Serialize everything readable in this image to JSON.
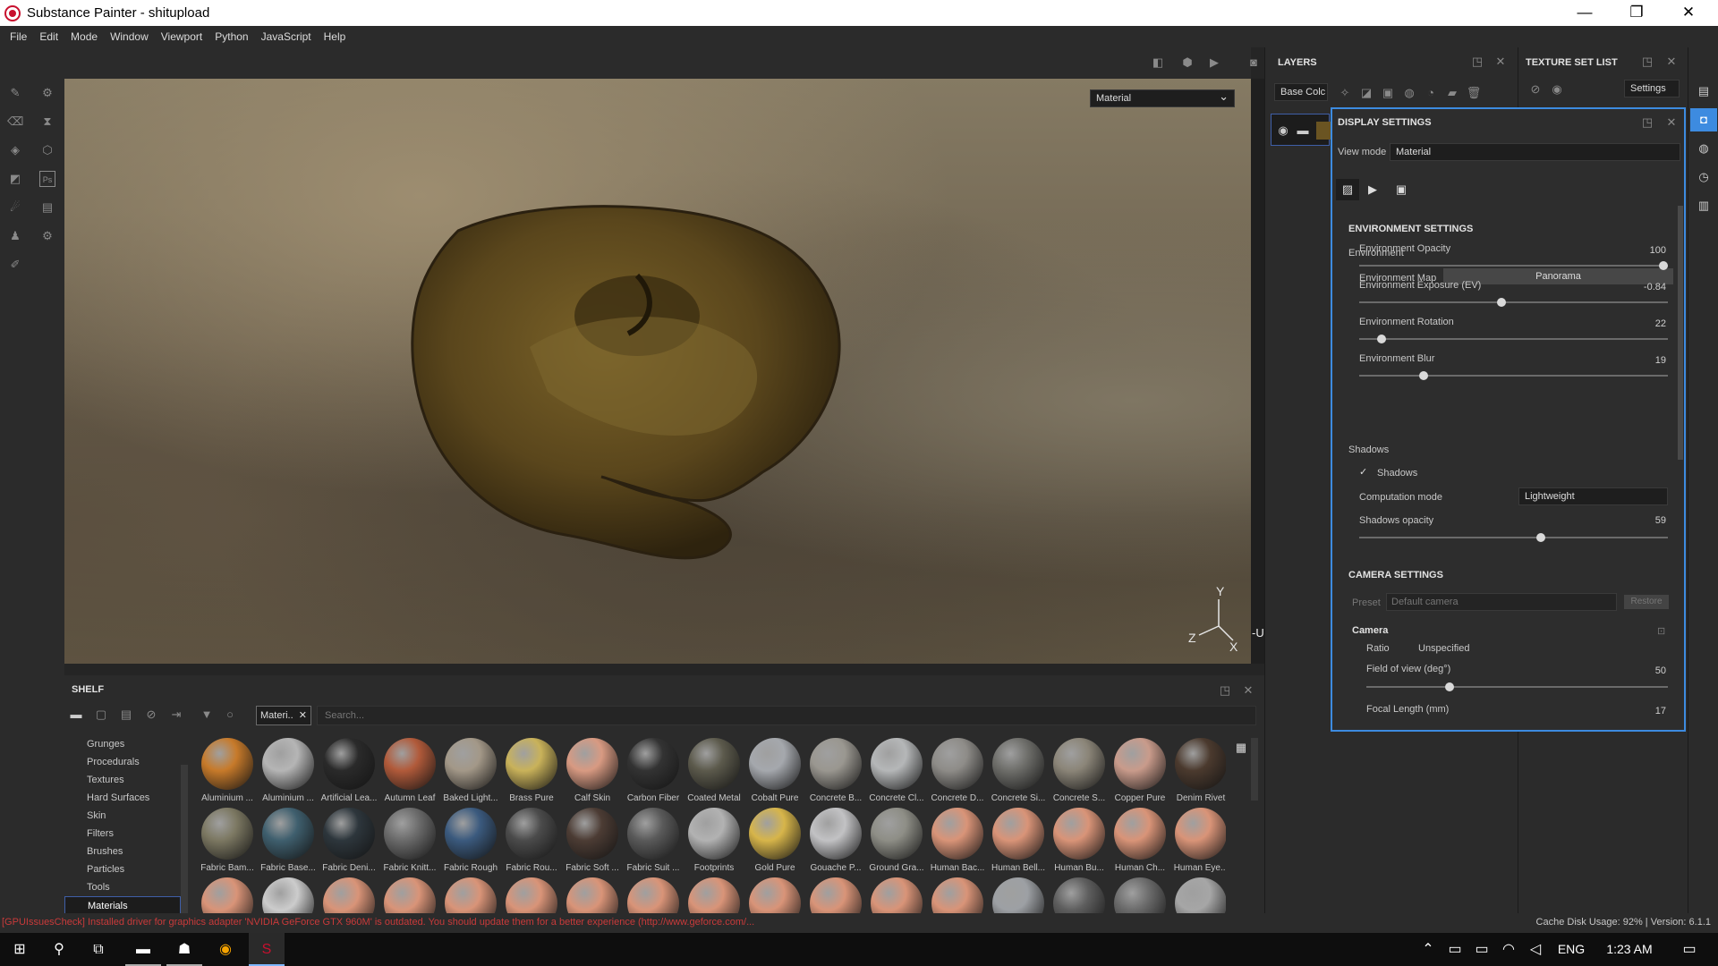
{
  "window": {
    "title": "Substance Painter - shitupload",
    "controls": [
      "—",
      "❐",
      "✕"
    ]
  },
  "menu": [
    "File",
    "Edit",
    "Mode",
    "Window",
    "Viewport",
    "Python",
    "JavaScript",
    "Help"
  ],
  "viewport": {
    "mode_select": "Material",
    "gizmo_labels": {
      "y": "Y",
      "z": "Z",
      "x": "X",
      "u": "-U"
    }
  },
  "layers": {
    "title": "LAYERS",
    "channel_select": "Base Colc"
  },
  "texture_set_list": {
    "title": "TEXTURE SET LIST",
    "settings_label": "Settings"
  },
  "display_settings": {
    "title": "DISPLAY SETTINGS",
    "view_mode_label": "View mode",
    "view_mode_value": "Material",
    "env_section": "ENVIRONMENT SETTINGS",
    "env_group": "Environment",
    "env_map_label": "Environment Map",
    "env_map_value": "Panorama",
    "sliders": [
      {
        "label": "Environment Opacity",
        "value": "100",
        "fraction": 1.0
      },
      {
        "label": "Environment Exposure (EV)",
        "value": "-0.84",
        "fraction": 0.46
      },
      {
        "label": "Environment Rotation",
        "value": "22",
        "fraction": 0.06
      },
      {
        "label": "Environment Blur",
        "value": "19",
        "fraction": 0.2
      }
    ],
    "shadows_group": "Shadows",
    "shadows_checkbox": "Shadows",
    "computation_label": "Computation mode",
    "computation_value": "Lightweight",
    "shadows_opacity_label": "Shadows opacity",
    "shadows_opacity_value": "59",
    "shadows_opacity_fraction": 0.59,
    "camera_section": "CAMERA SETTINGS",
    "preset_label": "Preset",
    "preset_placeholder": "Default camera",
    "restore_label": "Restore",
    "camera_group": "Camera",
    "ratio_label": "Ratio",
    "ratio_value": "Unspecified",
    "fov_label": "Field of view (deg°)",
    "fov_value": "50",
    "fov_fraction": 0.27,
    "focal_label": "Focal Length (mm)",
    "focal_value": "17"
  },
  "shelf": {
    "title": "SHELF",
    "filter_chip": "Materi..",
    "search_placeholder": "Search...",
    "categories": [
      "Grunges",
      "Procedurals",
      "Textures",
      "Hard Surfaces",
      "Skin",
      "Filters",
      "Brushes",
      "Particles",
      "Tools",
      "Materials"
    ],
    "selected_category": "Materials",
    "materials_row1": [
      {
        "name": "Aluminium ...",
        "color": "#c77a2a"
      },
      {
        "name": "Aluminium ...",
        "color": "#b5b5b5"
      },
      {
        "name": "Artificial Lea...",
        "color": "#2a2a2a"
      },
      {
        "name": "Autumn Leaf",
        "color": "#b15a3a"
      },
      {
        "name": "Baked Light...",
        "color": "#a39888"
      },
      {
        "name": "Brass Pure",
        "color": "#c9b25a"
      },
      {
        "name": "Calf Skin",
        "color": "#d89a82"
      },
      {
        "name": "Carbon Fiber",
        "color": "#333"
      },
      {
        "name": "Coated Metal",
        "color": "#5c5a4c"
      },
      {
        "name": "Cobalt Pure",
        "color": "#a5a8ad"
      },
      {
        "name": "Concrete B...",
        "color": "#9a9790"
      },
      {
        "name": "Concrete Cl...",
        "color": "#b5b7b8"
      },
      {
        "name": "Concrete D...",
        "color": "#8e8c88"
      },
      {
        "name": "Concrete Si...",
        "color": "#6e6e6a"
      },
      {
        "name": "Concrete S...",
        "color": "#8b8578"
      },
      {
        "name": "Copper Pure",
        "color": "#c99b8b"
      },
      {
        "name": "Denim Rivet",
        "color": "#4b3a2e"
      }
    ],
    "materials_row2": [
      {
        "name": "Fabric Bam...",
        "color": "#7c7862"
      },
      {
        "name": "Fabric Base...",
        "color": "#3f5f6e"
      },
      {
        "name": "Fabric Deni...",
        "color": "#2d363c"
      },
      {
        "name": "Fabric Knitt...",
        "color": "#6b6b6b"
      },
      {
        "name": "Fabric Rough",
        "color": "#3b5a7e"
      },
      {
        "name": "Fabric Rou...",
        "color": "#4b4b4b"
      },
      {
        "name": "Fabric Soft ...",
        "color": "#4c3c34"
      },
      {
        "name": "Fabric Suit ...",
        "color": "#5a5a5a"
      },
      {
        "name": "Footprints",
        "color": "#b2b2b2"
      },
      {
        "name": "Gold Pure",
        "color": "#d7b54a"
      },
      {
        "name": "Gouache P...",
        "color": "#c2c2c4"
      },
      {
        "name": "Ground Gra...",
        "color": "#8e8e86"
      },
      {
        "name": "Human Bac...",
        "color": "#d99478"
      },
      {
        "name": "Human Bell...",
        "color": "#d99478"
      },
      {
        "name": "Human Bu...",
        "color": "#d99478"
      },
      {
        "name": "Human Ch...",
        "color": "#d99478"
      },
      {
        "name": "Human Eye...",
        "color": "#d99478"
      }
    ],
    "materials_row3_colors": [
      "#d99478",
      "#cccccc",
      "#d99478",
      "#d99478",
      "#d99478",
      "#d99478",
      "#d99478",
      "#d99478",
      "#d99478",
      "#d99478",
      "#d99478",
      "#d99478",
      "#d99478",
      "#9da0a4",
      "#5e5e5e",
      "#6b6b6b",
      "#a6a6a6"
    ]
  },
  "status": {
    "error": "[GPUIssuesCheck] Installed driver for graphics adapter 'NVIDIA GeForce GTX 960M' is outdated. You should update them for a better experience (http://www.geforce.com/...",
    "cache": "Cache Disk Usage:    92% | Version: 6.1.1"
  },
  "taskbar": {
    "lang": "ENG",
    "time": "1:23 AM"
  }
}
